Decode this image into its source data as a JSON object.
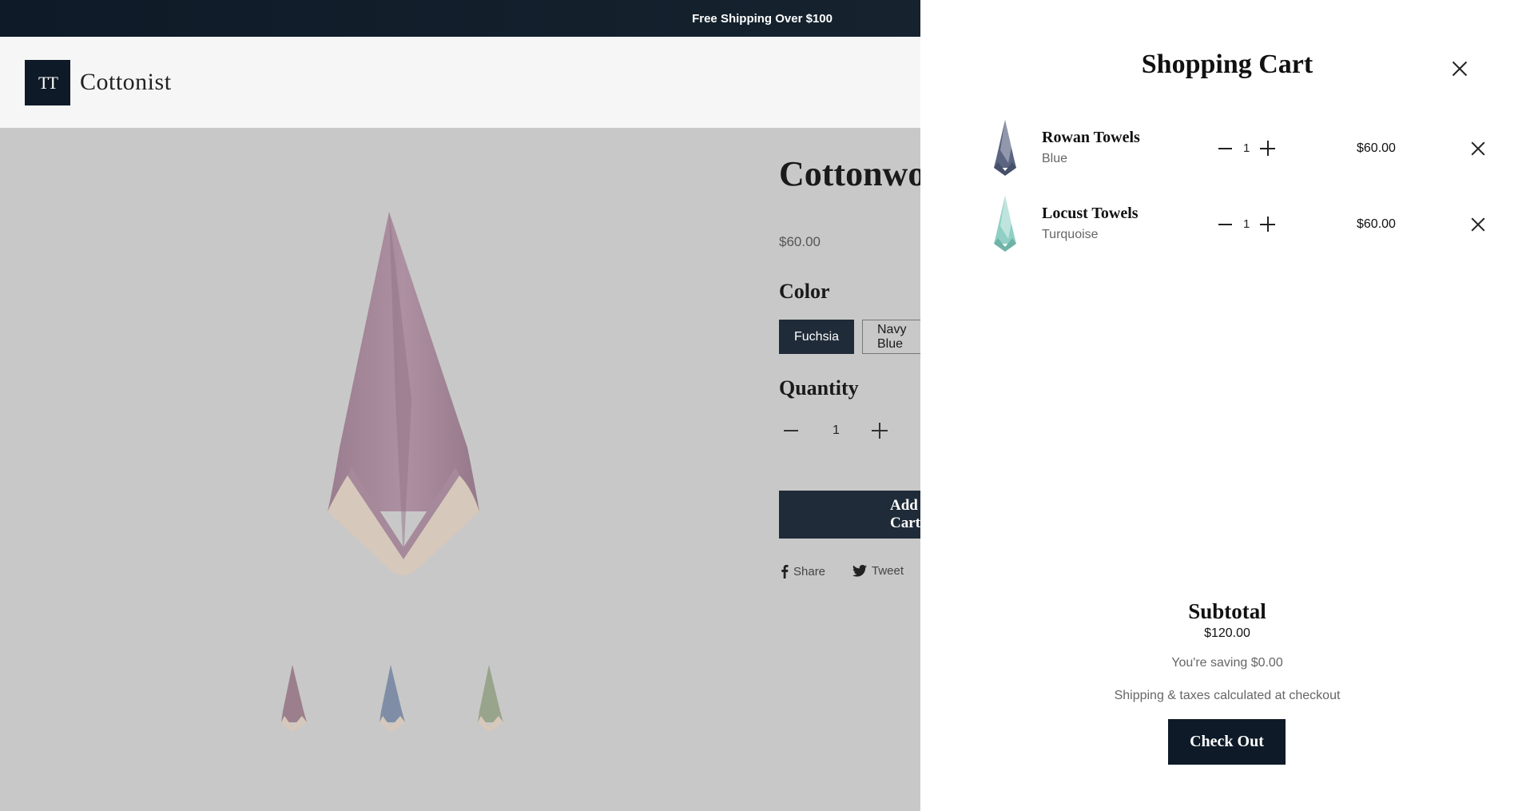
{
  "announcement": "Free Shipping Over $100",
  "brand": {
    "mark": "TT",
    "name": "Cottonist"
  },
  "product": {
    "title": "Cottonwood Towels",
    "price": "$60.00",
    "color_heading": "Color",
    "colors": [
      "Fuchsia",
      "Navy Blue"
    ],
    "selected_color": "Fuchsia",
    "quantity_heading": "Quantity",
    "quantity": "1",
    "add_button": "Add to Cart",
    "share_label": "Share",
    "tweet_label": "Tweet",
    "thumbnail_colors": [
      "#9b7f8c",
      "#7f8ea6",
      "#98a48c"
    ],
    "main_color": "#a6899a"
  },
  "cart": {
    "title": "Shopping Cart",
    "items": [
      {
        "name": "Rowan Towels",
        "variant": "Blue",
        "quantity": "1",
        "price": "$60.00",
        "color": "#5b6480"
      },
      {
        "name": "Locust Towels",
        "variant": "Turquoise",
        "quantity": "1",
        "price": "$60.00",
        "color": "#8fcfc4"
      }
    ],
    "subtotal_label": "Subtotal",
    "subtotal": "$120.00",
    "saving": "You're saving $0.00",
    "shipping_note": "Shipping & taxes calculated at checkout",
    "checkout_label": "Check Out"
  },
  "colors": {
    "dark": "#0e1a27",
    "button": "#1f2b38"
  }
}
